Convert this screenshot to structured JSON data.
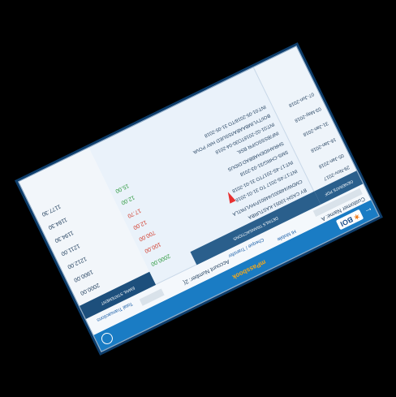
{
  "app": {
    "logo_text": "BOI",
    "title": "mPassbook",
    "back_glyph": "←"
  },
  "subbar": {
    "customer_name_label": "Customer Name: A",
    "account_number_label": "Account Number: 2(",
    "link_1": "Hi Mobile",
    "link_2": "Cheque / Transfer",
    "link_3": "Total Transactions"
  },
  "headers": {
    "date": "GENERATE PDF",
    "details": "DETAILS TRANSACTIONS",
    "balance": "EMAIL STATEMENT"
  },
  "dates": [
    "29-Nov-2017",
    "05-Jan-2018",
    "16-Jan-2018",
    "31-Jan-2018",
    "03-May-2018",
    "07-Jun-2018"
  ],
  "descriptions": [
    "BY CASH-10051-KASTURBA",
    "CMDW/448001/44801P/HVLPATLA",
    "INT:17:4S-2017 TO 31-01-2018",
    "INT:17-4S-2017TO 31-01-2018",
    "SMS-CHRG/31-03-2018",
    "SHRAHIDEHABBAD:DIDUS",
    "INF/BSSSO/PR BSIL",
    "INT:01-02-2018TO30-04-2018",
    "BOI/TYLIMBAABA/ISSUED HAY POVA",
    "INT:01-05-2018/TO 31-05-2018"
  ],
  "amounts": [
    {
      "value": "2000.00",
      "kind": "credit"
    },
    {
      "value": "100.00",
      "kind": "debit"
    },
    {
      "value": "700.00",
      "kind": "debit"
    },
    {
      "value": "12.00",
      "kind": "debit"
    },
    {
      "value": "17.70",
      "kind": "debit"
    },
    {
      "value": "12.00",
      "kind": "credit"
    },
    {
      "value": "15.00",
      "kind": "credit"
    }
  ],
  "balances": [
    "2000.00",
    "1900.00",
    "1212.00",
    "1211.00",
    "1194.30",
    "1184.30",
    "1177.30"
  ],
  "colors": {
    "topbar": "#1a7cc4",
    "header": "#2a5f8c",
    "credit": "#2e9a3e",
    "debit": "#d23a2a",
    "brand_orange": "#f4a81b"
  }
}
